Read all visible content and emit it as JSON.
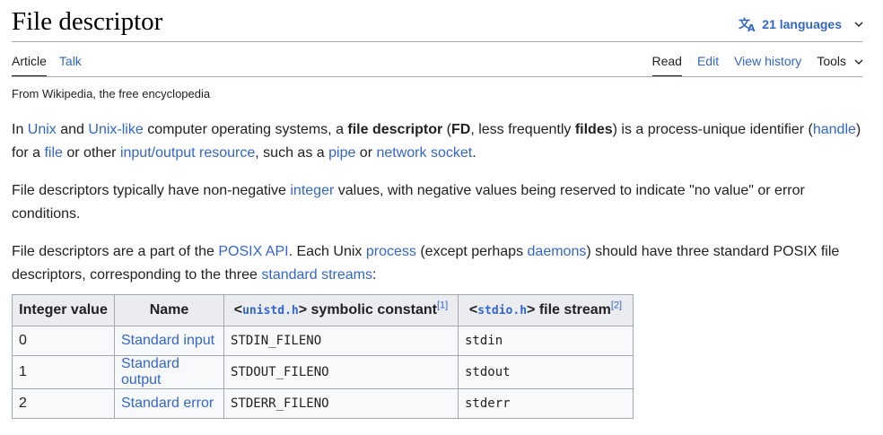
{
  "article": {
    "title": "File descriptor",
    "languages_label": "21 languages"
  },
  "tabs": {
    "left": [
      {
        "label": "Article"
      },
      {
        "label": "Talk"
      }
    ],
    "right": [
      {
        "label": "Read"
      },
      {
        "label": "Edit"
      },
      {
        "label": "View history"
      },
      {
        "label": "Tools"
      }
    ]
  },
  "tagline": "From Wikipedia, the free encyclopedia",
  "p1": {
    "t1": "In ",
    "l_unix": "Unix",
    "t2": " and ",
    "l_unixlike": "Unix-like",
    "t3": " computer operating systems, a ",
    "b_fd": "file descriptor",
    "t4": " (",
    "b_fd_abbr": "FD",
    "t5": ", less frequently ",
    "b_fildes": "fildes",
    "t6": ") is a process-unique identifier (",
    "l_handle": "handle",
    "t7": ") for a ",
    "l_file": "file",
    "t8": " or other ",
    "l_io": "input/output resource",
    "t9": ", such as a ",
    "l_pipe": "pipe",
    "t10": " or ",
    "l_socket": "network socket",
    "t11": "."
  },
  "p2": {
    "t1": "File descriptors typically have non-negative ",
    "l_integer": "integer",
    "t2": " values, with negative values being reserved to indicate \"no value\" or error conditions."
  },
  "p3": {
    "t1": "File descriptors are a part of the ",
    "l_posix": "POSIX API",
    "t2": ". Each Unix ",
    "l_process": "process",
    "t3": " (except perhaps ",
    "l_daemons": "daemons",
    "t4": ") should have three standard POSIX file descriptors, corresponding to the three ",
    "l_streams": "standard streams",
    "t5": ":"
  },
  "table": {
    "headers": {
      "integer": "Integer value",
      "name": "Name",
      "const_open": "<",
      "const_header": "unistd.h",
      "const_close": ">",
      "const_text": " symbolic constant",
      "const_ref": "[1]",
      "stream_open": "<",
      "stream_header": "stdio.h",
      "stream_close": ">",
      "stream_text": " file stream",
      "stream_ref": "[2]"
    },
    "rows": [
      {
        "value": "0",
        "name": "Standard input",
        "constant": "STDIN_FILENO",
        "stream": "stdin"
      },
      {
        "value": "1",
        "name": "Standard output",
        "constant": "STDOUT_FILENO",
        "stream": "stdout"
      },
      {
        "value": "2",
        "name": "Standard error",
        "constant": "STDERR_FILENO",
        "stream": "stderr"
      }
    ]
  },
  "icons": {
    "language": "translate-icon",
    "chevron": "chevron-down-icon"
  },
  "colors": {
    "link": "#3366cc",
    "text": "#202122",
    "border": "#a2a9b1",
    "table_bg": "#f8f9fa",
    "header_bg": "#eaecf0"
  }
}
